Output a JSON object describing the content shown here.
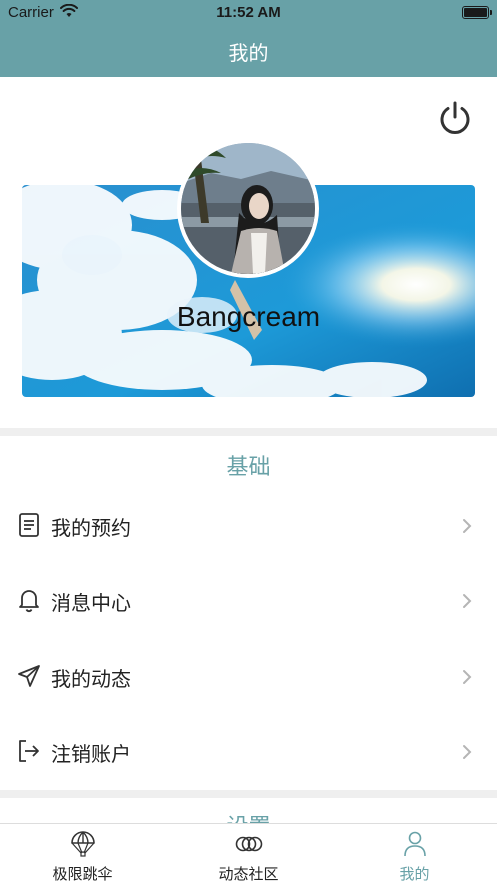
{
  "status_bar": {
    "carrier": "Carrier",
    "time": "11:52 AM"
  },
  "nav": {
    "title": "我的"
  },
  "profile": {
    "username": "Bangcream"
  },
  "sections": {
    "basic": {
      "title": "基础",
      "items": [
        {
          "label": "我的预约",
          "icon": "document-icon"
        },
        {
          "label": "消息中心",
          "icon": "bell-icon"
        },
        {
          "label": "我的动态",
          "icon": "paper-plane-icon"
        },
        {
          "label": "注销账户",
          "icon": "logout-icon"
        }
      ]
    },
    "settings": {
      "title": "设置"
    }
  },
  "tabbar": {
    "items": [
      {
        "label": "极限跳伞",
        "icon": "parachute-icon"
      },
      {
        "label": "动态社区",
        "icon": "rings-icon"
      },
      {
        "label": "我的",
        "icon": "person-icon"
      }
    ],
    "active_color": "#68a1a7"
  },
  "colors": {
    "accent": "#68a1a7",
    "divider": "#efefef"
  }
}
